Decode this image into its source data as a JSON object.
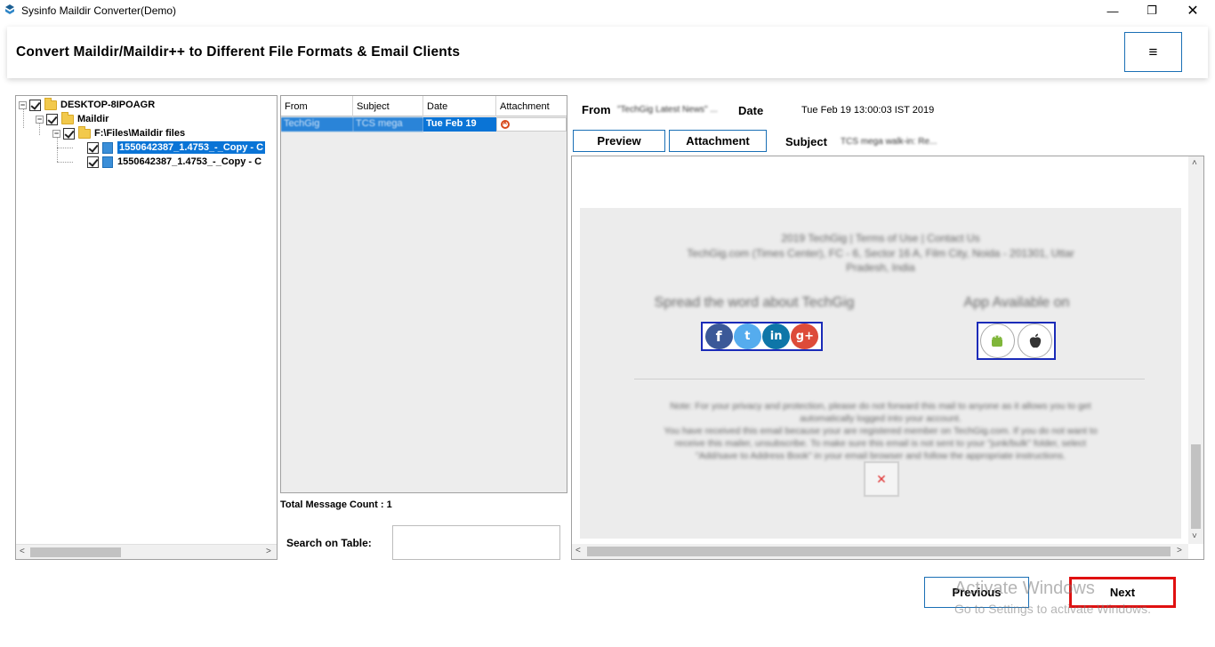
{
  "window": {
    "title": "Sysinfo Maildir Converter(Demo)",
    "minimize": "—",
    "maximize": "❐",
    "close": "✕"
  },
  "header": {
    "title": "Convert Maildir/Maildir++ to Different File Formats & Email Clients",
    "menu_icon": "≡"
  },
  "tree": {
    "root": "DESKTOP-8IPOAGR",
    "maildir": "Maildir",
    "folder": "F:\\Files\\Maildir files",
    "files": [
      "1550642387_1.4753_-_Copy - C",
      "1550642387_1.4753_-_Copy - C"
    ]
  },
  "message_list": {
    "columns": [
      "From",
      "Subject",
      "Date",
      "Attachment"
    ],
    "rows": [
      {
        "from": "TechGig",
        "subject": "TCS mega",
        "date": "Tue Feb 19"
      }
    ],
    "count_label": "Total Message Count : 1",
    "search_label": "Search on Table:",
    "search_value": ""
  },
  "details": {
    "from_label": "From",
    "from_value": "\"TechGig Latest News\" ...",
    "date_label": "Date",
    "date_value": "Tue Feb 19 13:00:03 IST 2019",
    "preview_tab": "Preview",
    "attachment_tab": "Attachment",
    "subject_label": "Subject",
    "subject_value": "TCS mega walk-in: Re..."
  },
  "preview": {
    "footer_line1": "2019 TechGig | Terms of Use | Contact Us",
    "footer_line2": "TechGig.com (Times Center), FC - 6, Sector 16 A, Film City, Noida - 201301, Uttar",
    "footer_line3": "Pradesh, India",
    "spread_text": "Spread the word about TechGig",
    "app_text": "App Available on",
    "note_line1": "Note: For your privacy and protection, please do not forward this mail to anyone as it allows you to get",
    "note_line2": "automatically logged into your account.",
    "note_line3": "You have received this email because your are registered member on TechGig.com. If you do not want to",
    "note_line4": "receive this mailer, unsubscribe. To make sure this email is not sent to your \"junk/bulk\" folder, select",
    "note_line5": "\"Add/save to Address Book\" in your email browser and follow the appropriate instructions.",
    "social_icons": [
      "facebook-icon",
      "twitter-icon",
      "linkedin-icon",
      "google-plus-icon"
    ],
    "app_icons": [
      "android-icon",
      "apple-icon"
    ]
  },
  "nav": {
    "previous": "Previous",
    "next": "Next"
  },
  "watermark": {
    "line1": "Activate Windows",
    "line2": "Go to Settings to activate Windows."
  },
  "colors": {
    "accent": "#1a6fb5",
    "selection": "#0a74d6",
    "next_border": "#e01010"
  }
}
